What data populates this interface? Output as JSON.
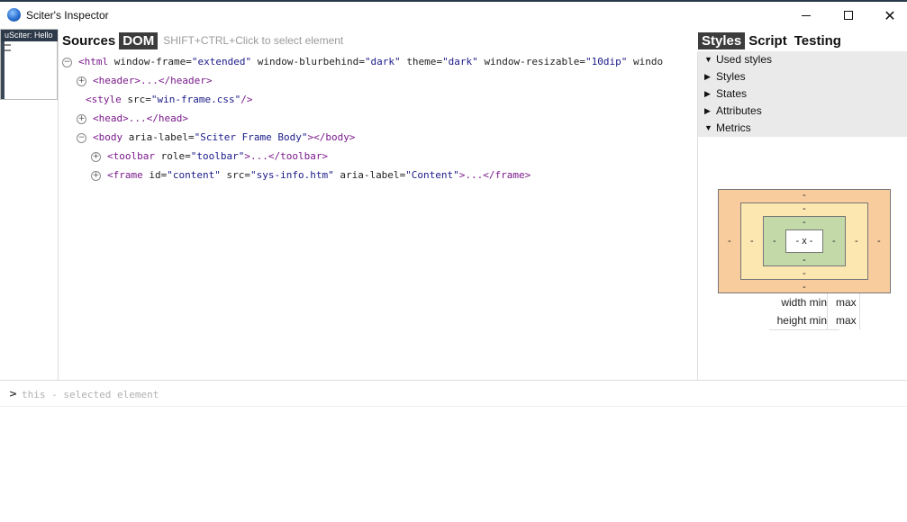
{
  "window": {
    "title": "Sciter's Inspector",
    "icon": "sciter-icon",
    "close_glyph": "✕"
  },
  "thumbnail": {
    "title": "uSciter: Hello"
  },
  "left_panel": {
    "tabs": [
      {
        "label": "Sources",
        "active": false
      },
      {
        "label": "DOM",
        "active": true
      }
    ],
    "hint": "SHIFT+CTRL+Click to select element"
  },
  "dom_tree": {
    "nodes": [
      {
        "toggle": "⊖",
        "tag_open": "<html",
        "attrs": [
          {
            "name": "window-frame",
            "value": "\"extended\""
          },
          {
            "name": "window-blurbehind",
            "value": "\"dark\""
          },
          {
            "name": "theme",
            "value": "\"dark\""
          },
          {
            "name": "window-resizable",
            "value": "\"10dip\""
          },
          {
            "name": "windo",
            "value": ""
          }
        ]
      },
      {
        "toggle": "⊕",
        "text": "<header>...</header>"
      },
      {
        "toggle": "",
        "tag_open": "<style",
        "attr_name": "src",
        "attr_value": "\"win-frame.css\"",
        "tag_close": "/>"
      },
      {
        "toggle": "⊕",
        "text": "<head>...</head>"
      },
      {
        "toggle": "⊖",
        "tag_open": "<body",
        "attr_name": "aria-label",
        "attr_value": "\"Sciter Frame Body\"",
        "tag_close": "></body>"
      },
      {
        "toggle": "⊕",
        "tag_open": "<toolbar",
        "attr_name": "role",
        "attr_value": "\"toolbar\"",
        "tag_close": ">...</toolbar>"
      },
      {
        "toggle": "⊕",
        "tag_open": "<frame",
        "attr1_name": "id",
        "attr1_value": "\"content\"",
        "attr2_name": "src",
        "attr2_value": "\"sys-info.htm\"",
        "attr3_name": "aria-label",
        "attr3_value": "\"Content\"",
        "tag_close": ">...</frame>"
      }
    ]
  },
  "right_panel": {
    "tabs": [
      {
        "label": "Styles",
        "active": true
      },
      {
        "label": "Script",
        "active": false
      },
      {
        "label": "Testing",
        "active": false
      }
    ],
    "sections": [
      {
        "label": "Used styles",
        "expanded": true
      },
      {
        "label": "Styles",
        "expanded": false
      },
      {
        "label": "States",
        "expanded": false
      },
      {
        "label": "Attributes",
        "expanded": false
      },
      {
        "label": "Metrics",
        "expanded": true
      }
    ]
  },
  "metrics": {
    "margin": "-",
    "border": "-",
    "padding": "-",
    "content": "- x -",
    "width_label": "width min",
    "width_value": "max",
    "height_label": "height min",
    "height_value": "max"
  },
  "console": {
    "prompt": ">",
    "placeholder": "this - selected element"
  }
}
